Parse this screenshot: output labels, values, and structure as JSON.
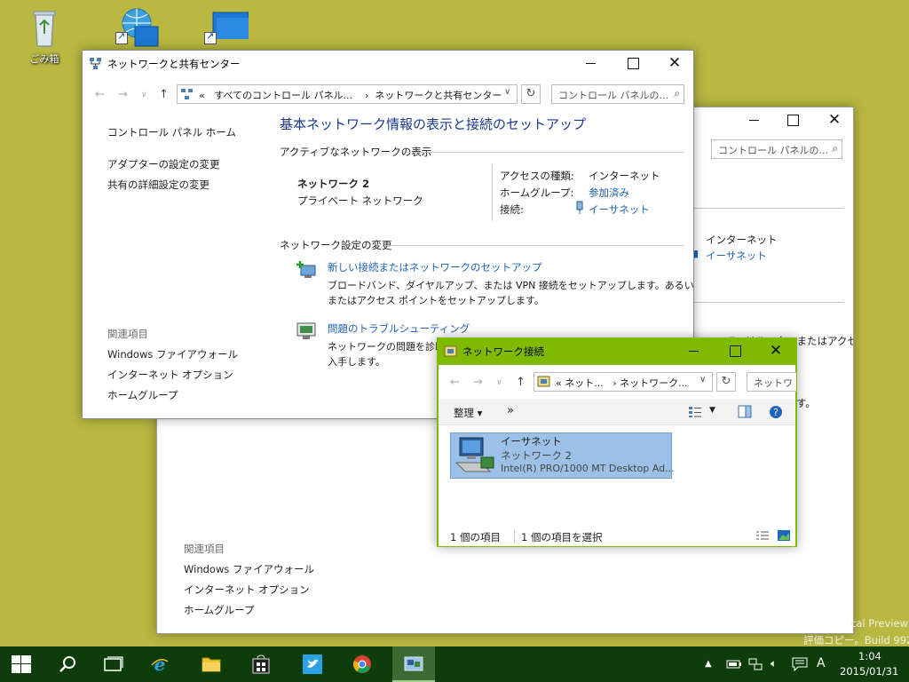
{
  "desktop": {
    "recycle_label": "ごみ箱",
    "watermark_line1": "cal Preview",
    "watermark_line2": "評価コピー。Build 9926"
  },
  "nsc": {
    "title": "ネットワークと共有センター",
    "breadcrumb_prefix": "«",
    "breadcrumb_1": "すべてのコントロール パネル...",
    "breadcrumb_sep": "›",
    "breadcrumb_2": "ネットワークと共有センター",
    "search_placeholder": "コントロール パネルの...",
    "sidebar": {
      "home": "コントロール パネル ホーム",
      "adapter": "アダプターの設定の変更",
      "sharing": "共有の詳細設定の変更",
      "related_head": "関連項目",
      "firewall": "Windows ファイアウォール",
      "inet_options": "インターネット オプション",
      "homegroup": "ホームグループ"
    },
    "heading": "基本ネットワーク情報の表示と接続のセットアップ",
    "active_head": "アクティブなネットワークの表示",
    "network_name": "ネットワーク 2",
    "network_type": "プライベート ネットワーク",
    "access_label": "アクセスの種類:",
    "access_value": "インターネット",
    "homegroup_label": "ホームグループ:",
    "homegroup_value": "参加済み",
    "conn_label": "接続:",
    "conn_value": "イーサネット",
    "change_head": "ネットワーク設定の変更",
    "new_conn_link": "新しい接続またはネットワークのセットアップ",
    "new_conn_desc_1": "ブロードバンド、ダイヤルアップ、または VPN 接続をセットアップします。あるいは、ルーター",
    "new_conn_desc_2": "またはアクセス ポイントをセットアップします。",
    "trouble_link": "問題のトラブルシューティング",
    "trouble_desc_1": "ネットワークの問題を診断し",
    "trouble_desc_2": "入手します。"
  },
  "backwin": {
    "search_placeholder": "コントロール パネルの...",
    "access_value": "インターネット",
    "conn_value": "イーサネット",
    "partial_text_1": "ていはルーターまたはアクセス ポイン",
    "partial_text_2": "す。",
    "related_head": "関連項目",
    "firewall": "Windows ファイアウォール",
    "inet_options": "インターネット オプション",
    "homegroup": "ホームグループ"
  },
  "netconn": {
    "title": "ネットワーク接続",
    "breadcrumb_prefix": "«",
    "breadcrumb_1": "ネット...",
    "breadcrumb_sep": "›",
    "breadcrumb_2": "ネットワーク...",
    "search_placeholder": "ネットワ",
    "organize": "整理 ▾",
    "more": "»",
    "item_name": "イーサネット",
    "item_network": "ネットワーク 2",
    "item_adapter": "Intel(R) PRO/1000 MT Desktop Ad...",
    "status_count": "1 個の項目",
    "status_selected": "1 個の項目を選択",
    "accent": "#7fba00"
  },
  "taskbar": {
    "time": "1:04",
    "date": "2015/01/31",
    "ime": "A",
    "color": "#0d3d0a"
  }
}
